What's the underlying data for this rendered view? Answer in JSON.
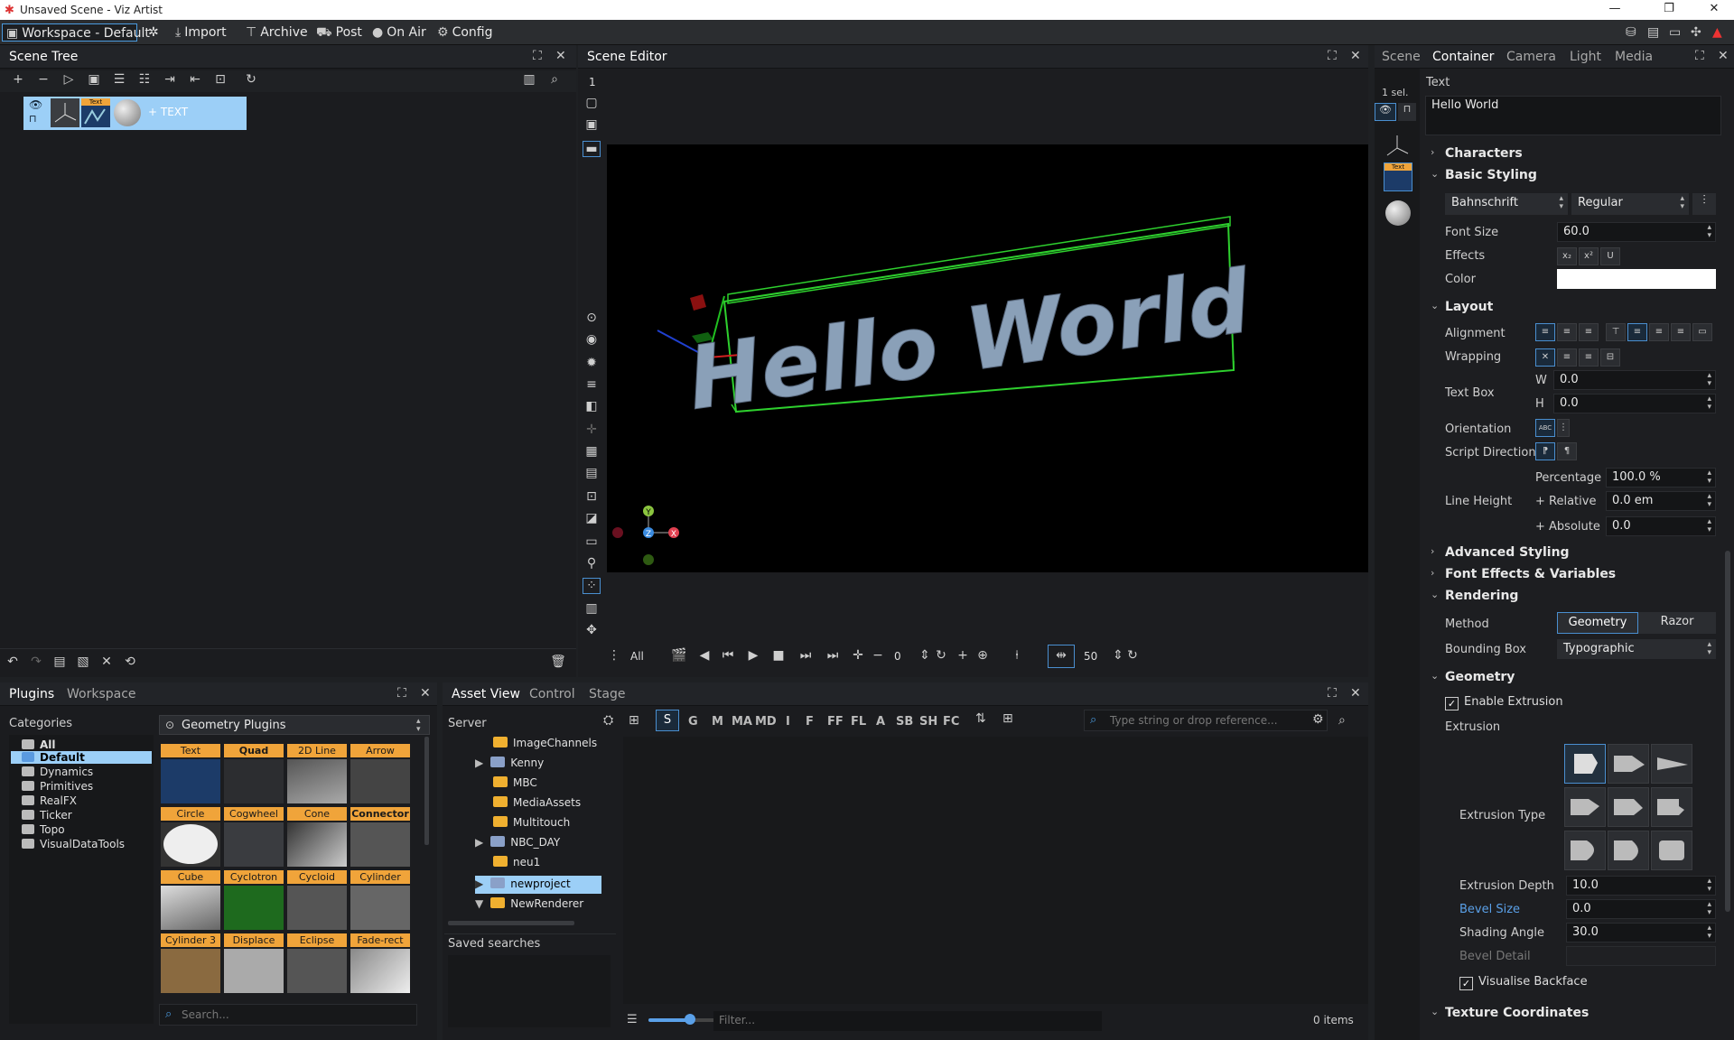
{
  "window": {
    "title": "Unsaved Scene - Viz Artist"
  },
  "menubar": {
    "workspace": "Workspace - Default",
    "items": [
      "Import",
      "Archive",
      "Post",
      "On Air",
      "Config"
    ]
  },
  "scene_tree": {
    "title": "Scene Tree",
    "node_label": "+ TEXT",
    "node_badge": "Text"
  },
  "scene_editor": {
    "title": "Scene Editor",
    "layer_number": "1",
    "text_3d": "Hello World",
    "timeline": {
      "label_all": "All",
      "frame": "0",
      "fps": "50"
    }
  },
  "properties": {
    "tabs": [
      "Scene",
      "Container",
      "Camera",
      "Light",
      "Media"
    ],
    "active_tab": "Container",
    "selection": "1 sel.",
    "text_label": "Text",
    "text_value": "Hello World",
    "node_badge": "Text",
    "sections": {
      "characters": "Characters",
      "basic_styling": "Basic Styling",
      "layout": "Layout",
      "advanced_styling": "Advanced Styling",
      "font_effects": "Font Effects & Variables",
      "rendering": "Rendering",
      "geometry": "Geometry",
      "texture": "Texture Coordinates"
    },
    "font_family": "Bahnschrift",
    "font_style": "Regular",
    "font_size_label": "Font Size",
    "font_size": "60.0",
    "effects_label": "Effects",
    "color_label": "Color",
    "color_value": "#ffffff",
    "alignment_label": "Alignment",
    "wrapping_label": "Wrapping",
    "textbox_label": "Text Box",
    "w_label": "W",
    "w_value": "0.0",
    "h_label": "H",
    "h_value": "0.0",
    "orientation_label": "Orientation",
    "script_dir_label": "Script Direction",
    "percentage_label": "Percentage",
    "percentage_value": "100.0 %",
    "line_height_label": "Line Height",
    "relative_label": "+ Relative",
    "relative_value": "0.0 em",
    "absolute_label": "+ Absolute",
    "absolute_value": "0.0",
    "method_label": "Method",
    "method_geometry": "Geometry",
    "method_razor": "Razor",
    "bbox_label": "Bounding Box",
    "bbox_value": "Typographic",
    "enable_extrusion": "Enable Extrusion",
    "extrusion_label": "Extrusion",
    "extrusion_type_label": "Extrusion Type",
    "extrusion_depth_label": "Extrusion Depth",
    "extrusion_depth": "10.0",
    "bevel_size_label": "Bevel Size",
    "bevel_size": "0.0",
    "shading_angle_label": "Shading Angle",
    "shading_angle": "30.0",
    "bevel_detail_label": "Bevel Detail",
    "visualise_backface": "Visualise Backface"
  },
  "plugins": {
    "tabs": [
      "Plugins",
      "Workspace"
    ],
    "categories_label": "Categories",
    "categories": [
      "All",
      "Default",
      "Dynamics",
      "Primitives",
      "RealFX",
      "Ticker",
      "Topo",
      "VisualDataTools"
    ],
    "selected_category": "Default",
    "group_title": "Geometry Plugins",
    "items": [
      "Text",
      "Quad",
      "2D Line",
      "Arrow",
      "Circle",
      "Cogwheel",
      "Cone",
      "Connector",
      "Cube",
      "Cyclotron",
      "Cycloid",
      "Cylinder",
      "Cylinder 3",
      "Displace",
      "Eclipse",
      "Fade-rect"
    ],
    "search_placeholder": "Search..."
  },
  "assets": {
    "tabs": [
      "Asset View",
      "Control",
      "Stage"
    ],
    "server_label": "Server",
    "filters": [
      "S",
      "G",
      "M",
      "MA",
      "MD",
      "I",
      "F",
      "FF",
      "FL",
      "A",
      "SB",
      "SH",
      "FC"
    ],
    "search_placeholder": "Type string or drop reference...",
    "tree": [
      "ImageChannels",
      "Kenny",
      "MBC",
      "MediaAssets",
      "Multitouch",
      "NBC_DAY",
      "neu1",
      "newproject",
      "NewRenderer"
    ],
    "selected": "newproject",
    "saved_searches": "Saved searches",
    "filter_placeholder": "Filter...",
    "count": "0 items"
  }
}
